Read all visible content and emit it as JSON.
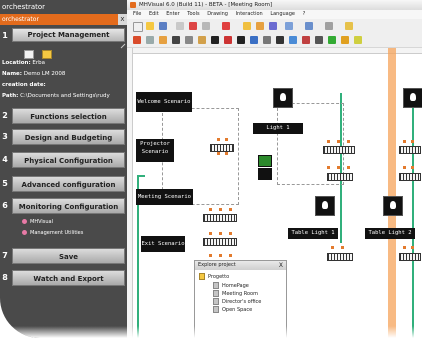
{
  "left_panel": {
    "app_title": "orchestrator",
    "subtitle": "orchestrator",
    "close_glyph": "x",
    "project_management": "Project Management",
    "location_label": "Location:",
    "location_value": "Erba",
    "name_label": "Name:",
    "name_value": "Demo LM 2008",
    "creation_label": "creation date:",
    "path_label": "Path:",
    "path_value": "C:\\Documents and Settings\\rudy",
    "steps": [
      {
        "num": "2",
        "label": "Functions selection"
      },
      {
        "num": "3",
        "label": "Design and Budgeting"
      },
      {
        "num": "4",
        "label": "Physical Configuration"
      },
      {
        "num": "5",
        "label": "Advanced configuration"
      },
      {
        "num": "6",
        "label": "Monitoring Configuration"
      },
      {
        "num": "7",
        "label": "Save"
      },
      {
        "num": "8",
        "label": "Watch and Export"
      }
    ],
    "utilities": [
      "MHVisual",
      "Management Utilities"
    ]
  },
  "main_window": {
    "title": "MHVisual 6.0 (Build 11) - BETA - [Meeting Room]",
    "menu": [
      "File",
      "Edit",
      "Enter",
      "Tools",
      "Drawing",
      "Interaction",
      "Language",
      "?"
    ],
    "scenarios": {
      "welcome": "Welcome Scenario",
      "projector": "Projector Scenario",
      "meeting": "Meeting Scenario",
      "exit": "Exit Scenario"
    },
    "lights": {
      "light1": "Light 1",
      "table_light1": "Table Light 1",
      "table_light2": "Table Light 2"
    }
  },
  "explore_project": {
    "title": "Explore project",
    "close_glyph": "X",
    "root": "Progetto",
    "items": [
      "HomePage",
      "Meeting Room",
      "Director's office",
      "Open Space"
    ]
  },
  "colors": {
    "accent_orange": "#e36b1c",
    "panel_dark": "#4a4a4a",
    "connector_green": "#31b07c"
  }
}
